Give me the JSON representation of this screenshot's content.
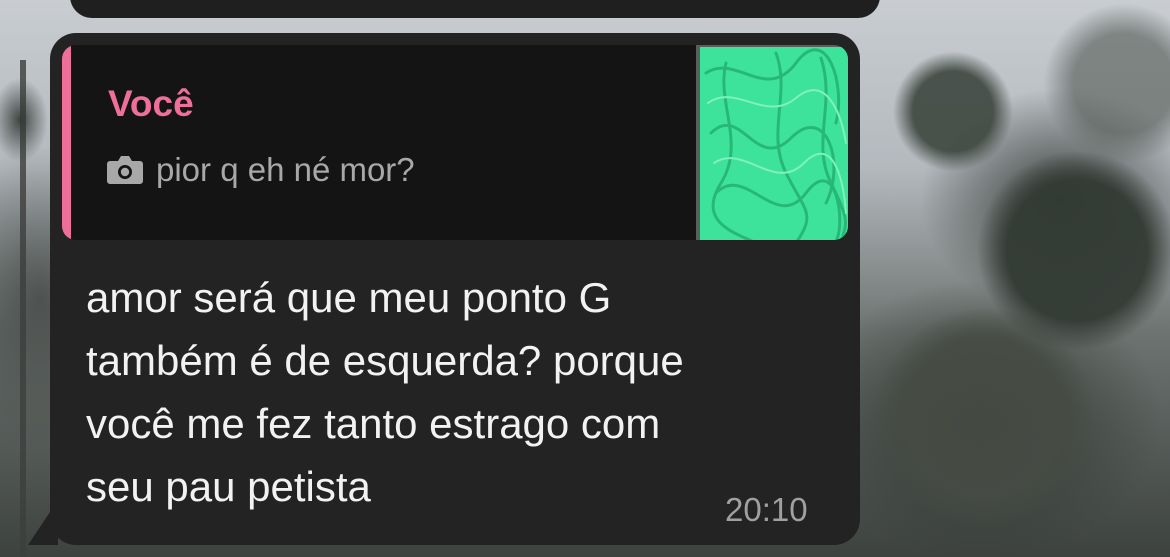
{
  "quote": {
    "author": "Você",
    "preview_icon": "camera-icon",
    "preview_text": "pior q eh né mor?",
    "author_color": "#ef6f9b",
    "thumbnail_scribble_color": "#3de39b"
  },
  "message": {
    "text": "amor será que meu ponto G\ntambém é de esquerda? porque\nvocê me fez tanto estrago com\nseu pau petista",
    "time": "20:10"
  },
  "colors": {
    "bubble_background": "#232323",
    "quote_background": "#141414",
    "text": "#f2f2f2",
    "timestamp": "#a0a0a0"
  }
}
